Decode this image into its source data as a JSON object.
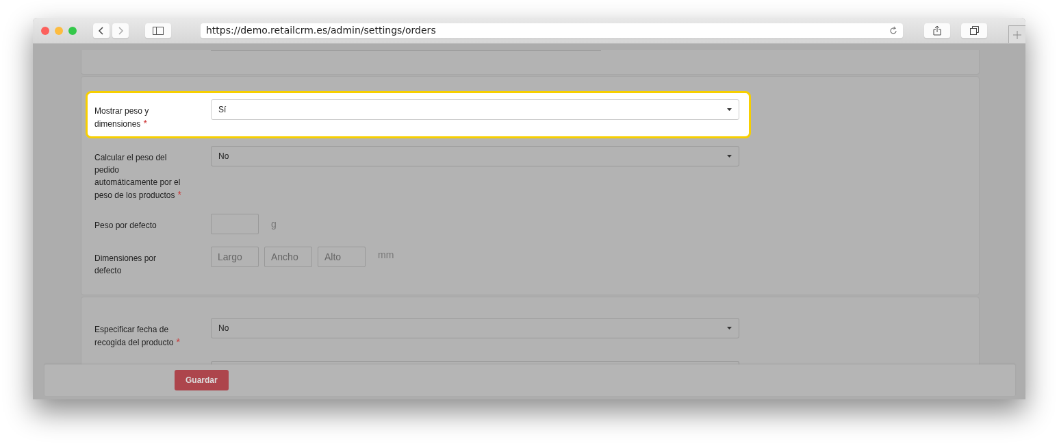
{
  "browser": {
    "url": "https://demo.retailcrm.es/admin/settings/orders"
  },
  "sections": [
    {
      "kind": "partial"
    },
    {
      "kind": "card",
      "fields": [
        {
          "kind": "select",
          "label": "Mostrar peso y dimensiones",
          "required_mark": "*",
          "value": "Sí",
          "highlighted": true
        },
        {
          "kind": "select",
          "label": "Calcular el peso del pedido automáticamente por el peso de los productos",
          "required_mark": "*",
          "value": "No",
          "highlighted": false
        },
        {
          "kind": "input",
          "label": "Peso por defecto",
          "unit": "g",
          "highlighted": false
        },
        {
          "kind": "inputs",
          "label": "Dimensiones por defecto",
          "placeholders": [
            "Largo",
            "Ancho",
            "Alto"
          ],
          "unit": "mm",
          "highlighted": false
        }
      ]
    },
    {
      "kind": "card",
      "fields": [
        {
          "kind": "select",
          "label": "Especificar fecha de recogida del producto",
          "required_mark": "*",
          "value": "No",
          "highlighted": false
        },
        {
          "kind": "select",
          "highlighted": false
        }
      ]
    }
  ],
  "footer": {
    "save_button": "Guardar"
  }
}
